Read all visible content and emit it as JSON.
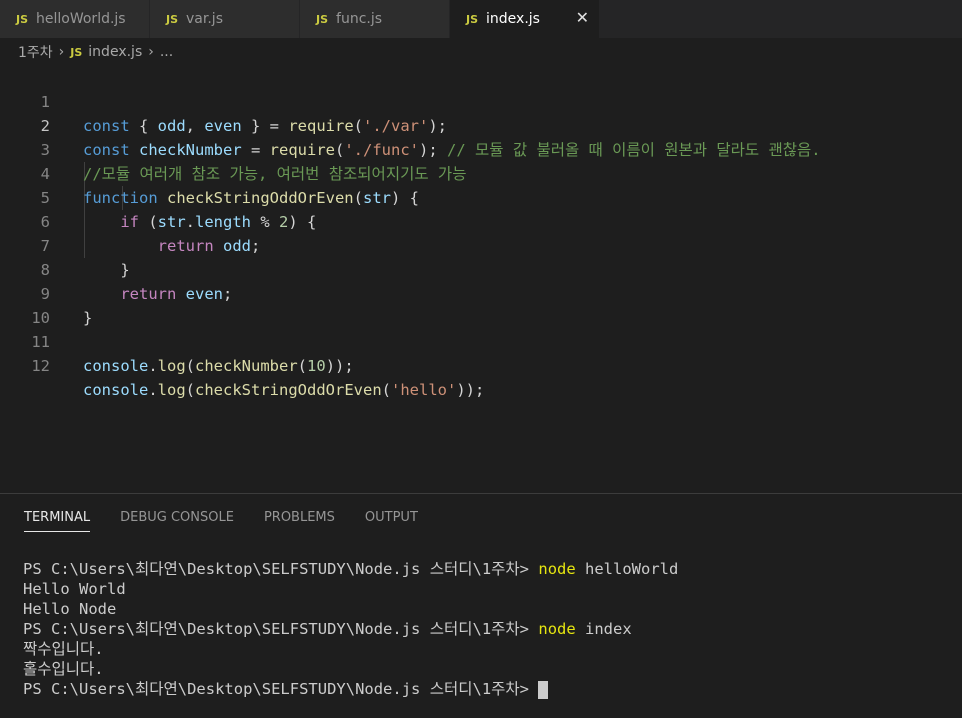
{
  "tabs": [
    {
      "icon": "JS",
      "label": "helloWorld.js"
    },
    {
      "icon": "JS",
      "label": "var.js"
    },
    {
      "icon": "JS",
      "label": "func.js"
    },
    {
      "icon": "JS",
      "label": "index.js",
      "active": true
    }
  ],
  "close_glyph": "✕",
  "breadcrumb": {
    "folder": "1주차",
    "icon": "JS",
    "file": "index.js",
    "more": "..."
  },
  "line_numbers": [
    "1",
    "2",
    "3",
    "4",
    "5",
    "6",
    "7",
    "8",
    "9",
    "10",
    "11",
    "12"
  ],
  "code": {
    "l1": {
      "a": "const",
      "b": " { ",
      "c": "odd",
      ",": ", ",
      "d": "even",
      "e": " } = ",
      "f": "require",
      "g": "(",
      "h": "'./var'",
      "i": ");"
    },
    "l2": {
      "a": "const",
      "b": " ",
      "c": "checkNumber",
      "d": " = ",
      "e": "require",
      "f": "(",
      "g": "'./func'",
      "h": "); ",
      "i": "// 모듈 값 불러올 때 이름이 원본과 달라도 괜찮음."
    },
    "l3": {
      "a": "//모듈 여러개 참조 가능, 여러번 참조되어지기도 가능"
    },
    "l4": {
      "a": "function",
      "b": " ",
      "c": "checkStringOddOrEven",
      "d": "(",
      "e": "str",
      "f": ") {"
    },
    "l5": {
      "a": "    ",
      "b": "if",
      "c": " (",
      "d": "str",
      "e": ".",
      "f": "length",
      "g": " % ",
      "h": "2",
      "i": ") {"
    },
    "l6": {
      "a": "        ",
      "b": "return",
      "c": " ",
      "d": "odd",
      "e": ";"
    },
    "l7": {
      "a": "    }"
    },
    "l8": {
      "a": "    ",
      "b": "return",
      "c": " ",
      "d": "even",
      "e": ";"
    },
    "l9": {
      "a": "}"
    },
    "l10": {
      "a": ""
    },
    "l11": {
      "a": "console",
      "b": ".",
      "c": "log",
      "d": "(",
      "e": "checkNumber",
      "f": "(",
      "g": "10",
      "h": "));"
    },
    "l12": {
      "a": "console",
      "b": ".",
      "c": "log",
      "d": "(",
      "e": "checkStringOddOrEven",
      "f": "(",
      "g": "'hello'",
      "h": "));"
    }
  },
  "panel_tabs": [
    "TERMINAL",
    "DEBUG CONSOLE",
    "PROBLEMS",
    "OUTPUT"
  ],
  "terminal": {
    "prompt": "PS C:\\Users\\최다연\\Desktop\\SELFSTUDY\\Node.js 스터디\\1주차> ",
    "cmd1": "node",
    "arg1": " helloWorld",
    "out1": "Hello World",
    "out2": "Hello Node",
    "cmd2": "node",
    "arg2": " index",
    "out3": "짝수입니다.",
    "out4": "홀수입니다."
  },
  "colors": {
    "accent": "#cbcb41",
    "background": "#1e1e1e",
    "keyword": "#569cd6",
    "string": "#ce9178",
    "comment": "#6a9955"
  }
}
